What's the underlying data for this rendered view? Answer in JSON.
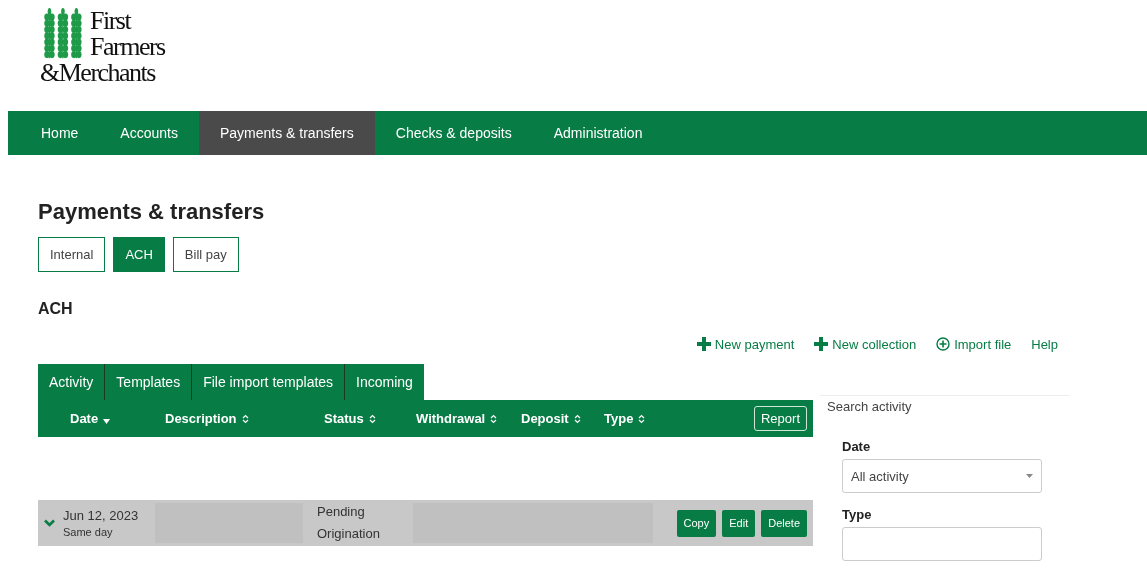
{
  "logo": {
    "lines": [
      "First",
      "Farmers",
      "&Merchants"
    ]
  },
  "nav": [
    {
      "label": "Home",
      "selected": false
    },
    {
      "label": "Accounts",
      "selected": false
    },
    {
      "label": "Payments & transfers",
      "selected": true
    },
    {
      "label": "Checks & deposits",
      "selected": false
    },
    {
      "label": "Administration",
      "selected": false
    }
  ],
  "page_title": "Payments & transfers",
  "subtabs": [
    {
      "label": "Internal",
      "selected": false
    },
    {
      "label": "ACH",
      "selected": true
    },
    {
      "label": "Bill pay",
      "selected": false
    }
  ],
  "section_title": "ACH",
  "actions": [
    {
      "label": "New payment",
      "kind": "plus"
    },
    {
      "label": "New collection",
      "kind": "plus"
    },
    {
      "label": "Import file",
      "kind": "circle-plus"
    },
    {
      "label": "Help",
      "kind": "plain"
    }
  ],
  "tabs": [
    {
      "label": "Activity"
    },
    {
      "label": "Templates"
    },
    {
      "label": "File import templates"
    },
    {
      "label": "Incoming"
    }
  ],
  "table": {
    "columns": [
      {
        "label": "Date",
        "sorted": true
      },
      {
        "label": "Description",
        "sorted": false
      },
      {
        "label": "Status",
        "sorted": false
      },
      {
        "label": "Withdrawal",
        "sorted": false
      },
      {
        "label": "Deposit",
        "sorted": false
      },
      {
        "label": "Type",
        "sorted": false
      }
    ],
    "report_button": "Report",
    "rows": [
      {
        "expanded": false,
        "date": "Jun 12, 2023",
        "speed": "Same day",
        "status": "Pending Origination",
        "buttons": [
          "Copy",
          "Edit",
          "Delete"
        ]
      }
    ]
  },
  "sidebar": {
    "title": "Search activity",
    "filters": [
      {
        "label": "Date",
        "value": "All activity"
      },
      {
        "label": "Type"
      }
    ]
  }
}
